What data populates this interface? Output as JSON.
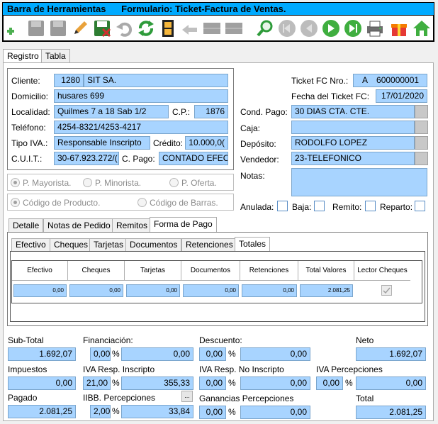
{
  "title": "Barra de Herramientas      Formulario: Ticket-Factura de Ventas.",
  "toolbar_icons": [
    "add-icon",
    "save-disabled-icon",
    "save-as-disabled-icon",
    "edit-icon",
    "save-exit-icon",
    "undo-disabled-icon",
    "refresh-icon",
    "film-icon",
    "back-disabled-icon",
    "grid-disabled-icon",
    "grid2-disabled-icon",
    "search-icon",
    "first-disabled-icon",
    "prev-disabled-icon",
    "next-icon",
    "last-icon",
    "print-icon",
    "gift-icon",
    "home-icon"
  ],
  "main_tabs": [
    "Registro",
    "Tabla"
  ],
  "client": {
    "cliente_label": "Cliente:",
    "cliente_code": "1280",
    "cliente_name": "SIT SA.",
    "domicilio_label": "Domicilio:",
    "domicilio": "husares  699",
    "localidad_label": "Localidad:",
    "localidad": "Quilmes 7 a 18 Sab 1/2",
    "cp_label": "C.P.:",
    "cp": "1876",
    "telefono_label": "Teléfono:",
    "telefono": "4254-8321/4253-4217",
    "tipo_iva_label": "Tipo IVA.:",
    "tipo_iva": "Responsable Inscripto",
    "credito_label": "Crédito:",
    "credito": "10.000,0(",
    "cuit_label": "C.U.I.T.:",
    "cuit": "30-67.923.272/(",
    "cpago_label": "C. Pago:",
    "cpago": "CONTADO EFEC"
  },
  "ticket": {
    "nro_label": "Ticket FC Nro.:",
    "letra": "A",
    "nro": "600000001",
    "fecha_label": "Fecha del Ticket FC:",
    "fecha": "17/01/2020",
    "cond_pago_label": "Cond. Pago:",
    "cond_pago": "30 DIAS CTA. CTE.",
    "caja_label": "Caja:",
    "caja": "",
    "deposito_label": "Depósito:",
    "deposito": "RODOLFO LOPEZ",
    "vendedor_label": "Vendedor:",
    "vendedor": "23-TELEFONICO",
    "notas_label": "Notas:",
    "notas": ""
  },
  "price_options": [
    "P. Mayorista.",
    "P. Minorista.",
    "P. Oferta."
  ],
  "code_options": [
    "Código de Producto.",
    "Código de Barras."
  ],
  "flags": {
    "anulada": "Anulada:",
    "baja": "Baja:",
    "remito": "Remito:",
    "reparto": "Reparto:"
  },
  "detail_tabs": [
    "Detalle",
    "Notas de Pedido",
    "Remitos",
    "Forma de Pago"
  ],
  "pago_tabs": [
    "Efectivo",
    "Cheques",
    "Tarjetas",
    "Documentos",
    "Retenciones",
    "Totales"
  ],
  "totales_grid": {
    "headers": [
      "Efectivo",
      "Cheques",
      "Tarjetas",
      "Documentos",
      "Retenciones",
      "Total Valores",
      "Lector Cheques"
    ],
    "values": [
      "0,00",
      "0,00",
      "0,00",
      "0,00",
      "0,00",
      "2.081,25"
    ]
  },
  "totals": {
    "subtotal_label": "Sub-Total",
    "subtotal": "1.692,07",
    "financiacion_label": "Financiación:",
    "financiacion_pct": "0,00",
    "financiacion": "0,00",
    "descuento_label": "Descuento:",
    "descuento_pct": "0,00",
    "descuento": "0,00",
    "neto_label": "Neto",
    "neto": "1.692,07",
    "impuestos_label": "Impuestos",
    "impuestos": "0,00",
    "iva_ri_label": "IVA Resp. Inscripto",
    "iva_ri_pct": "21,00",
    "iva_ri": "355,33",
    "iva_rni_label": "IVA Resp. No Inscripto",
    "iva_rni_pct": "0,00",
    "iva_rni": "0,00",
    "iva_perc_label": "IVA Percepciones",
    "iva_perc_pct": "0,00",
    "iva_perc": "0,00",
    "pagado_label": "Pagado",
    "pagado": "2.081,25",
    "iibb_label": "IIBB. Percepciones",
    "iibb_pct": "2,00",
    "iibb": "33,84",
    "iibb_btn": "...",
    "ganancias_label": "Ganancias Percepciones",
    "ganancias_pct": "0,00",
    "ganancias": "0,00",
    "total_label": "Total",
    "total": "2.081,25",
    "pct": "%"
  }
}
